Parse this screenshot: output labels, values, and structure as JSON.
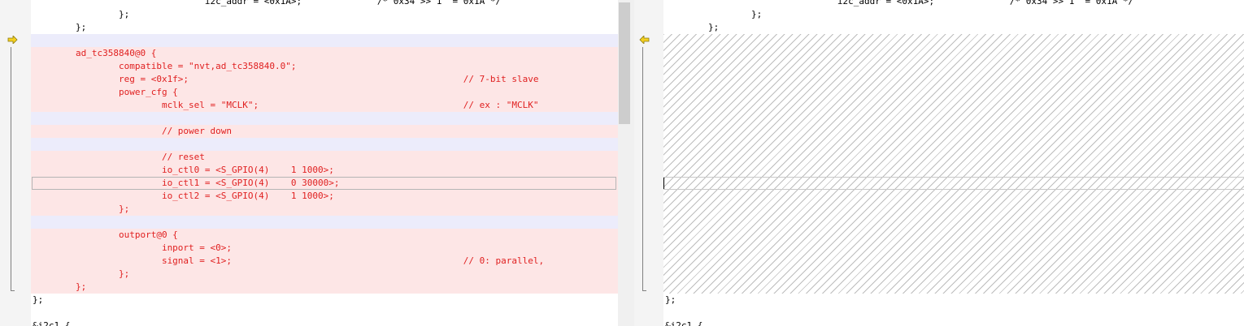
{
  "colors": {
    "deleted_text": "#e02020",
    "deleted_bg": "#fde6e6",
    "blank_bg": "#ececfb",
    "arrow_fill": "#f5d020"
  },
  "icons": {
    "left_marker": "arrow-right-icon",
    "right_marker": "arrow-left-icon"
  },
  "left": {
    "lines": [
      "                                i2c_addr = <0x1A>;              /* 0x34 >> 1  = 0x1A */",
      "                };",
      "        };",
      "",
      "        ad_tc358840@0 {",
      "                compatible = \"nvt,ad_tc358840.0\";",
      "                reg = <0x1f>;                                                   // 7-bit slave",
      "                power_cfg {",
      "                        mclk_sel = \"MCLK\";                                      // ex : \"MCLK\"",
      "",
      "                        // power down",
      "",
      "                        // reset",
      "                        io_ctl0 = <S_GPIO(4)    1 1000>;",
      "                        io_ctl1 = <S_GPIO(4)    0 30000>;",
      "                        io_ctl2 = <S_GPIO(4)    1 1000>;",
      "                };",
      "",
      "                outport@0 {",
      "                        inport = <0>;",
      "                        signal = <1>;                                           // 0: parallel,",
      "                };",
      "        };",
      "};",
      "",
      "&i2c1 {"
    ]
  },
  "right": {
    "top_lines": [
      "                                i2c_addr = <0x1A>;              /* 0x34 >> 1  = 0x1A */",
      "                };",
      "        };"
    ],
    "bottom_lines": [
      "};",
      "",
      "&i2c1 {"
    ]
  }
}
